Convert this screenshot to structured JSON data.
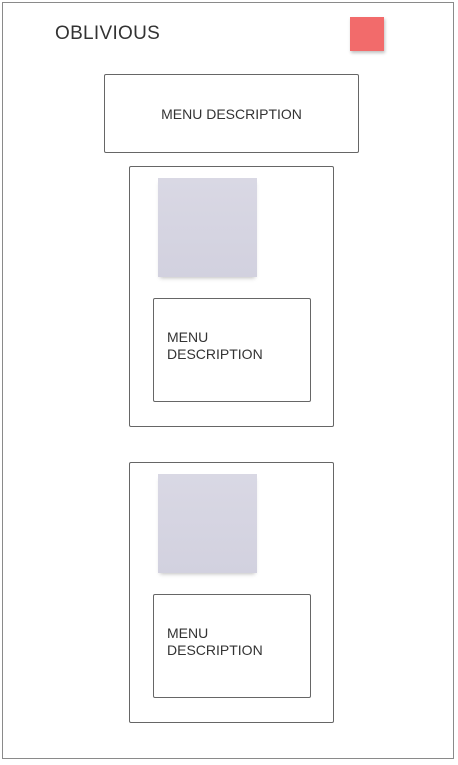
{
  "header": {
    "brand": "OBLIVIOUS",
    "menu_icon": "menu-icon",
    "menu_color": "#f26b6b"
  },
  "top_section": {
    "description": "MENU DESCRIPTION"
  },
  "cards": [
    {
      "image": "image-placeholder",
      "description_line1": "MENU",
      "description_line2": "DESCRIPTION"
    },
    {
      "image": "image-placeholder",
      "description_line1": "MENU",
      "description_line2": "DESCRIPTION"
    }
  ]
}
